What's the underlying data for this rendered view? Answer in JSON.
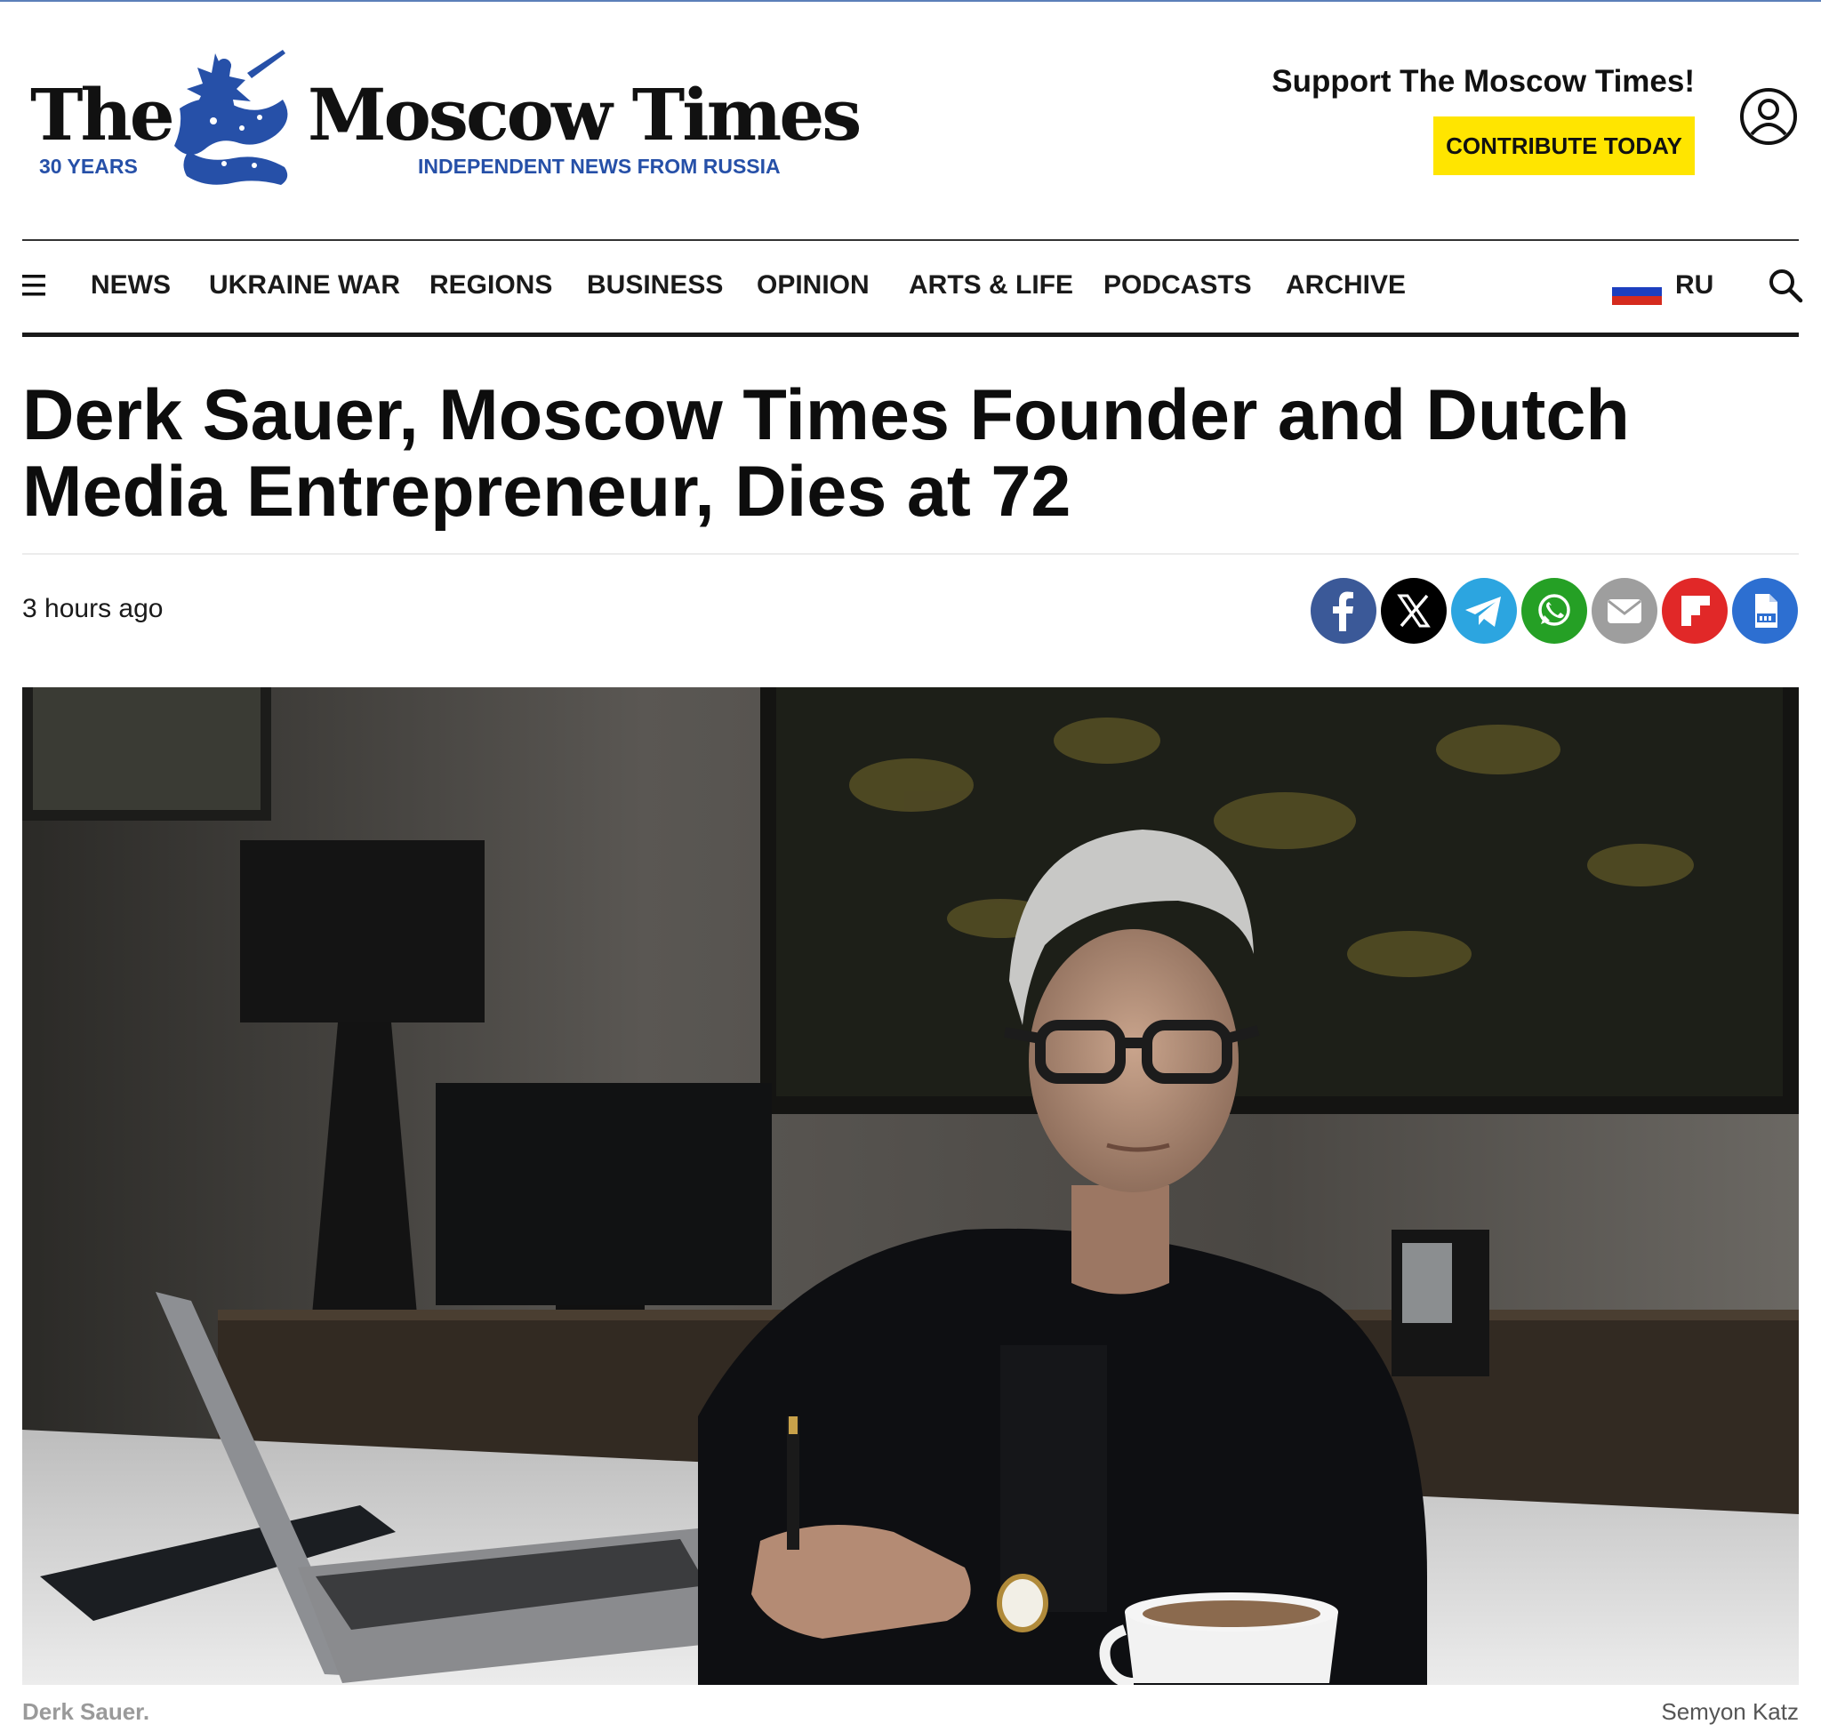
{
  "header": {
    "logo": {
      "the": "The",
      "name": "Moscow Times",
      "years": "30 YEARS",
      "tagline": "INDEPENDENT NEWS FROM RUSSIA"
    },
    "support_text": "Support The Moscow Times!",
    "contribute_label": "CONTRIBUTE TODAY"
  },
  "nav": {
    "items": [
      "NEWS",
      "UKRAINE WAR",
      "REGIONS",
      "BUSINESS",
      "OPINION",
      "ARTS & LIFE",
      "PODCASTS",
      "ARCHIVE"
    ],
    "language": "RU"
  },
  "article": {
    "headline": "Derk Sauer, Moscow Times Founder and Dutch Media Entrepreneur, Dies at 72",
    "time": "3 hours ago",
    "caption": "Derk Sauer.",
    "credit": "Semyon Katz"
  },
  "share": [
    {
      "icon": "facebook-icon",
      "color": "#3b5998"
    },
    {
      "icon": "x-icon",
      "color": "#000000"
    },
    {
      "icon": "telegram-icon",
      "color": "#2ca5e0"
    },
    {
      "icon": "whatsapp-icon",
      "color": "#25a025"
    },
    {
      "icon": "email-icon",
      "color": "#9e9e9e"
    },
    {
      "icon": "flipboard-icon",
      "color": "#e12828"
    },
    {
      "icon": "pdf-icon",
      "color": "#2d6fd1"
    }
  ],
  "colors": {
    "brand_blue": "#2650a8",
    "contribute_yellow": "#ffe500"
  }
}
